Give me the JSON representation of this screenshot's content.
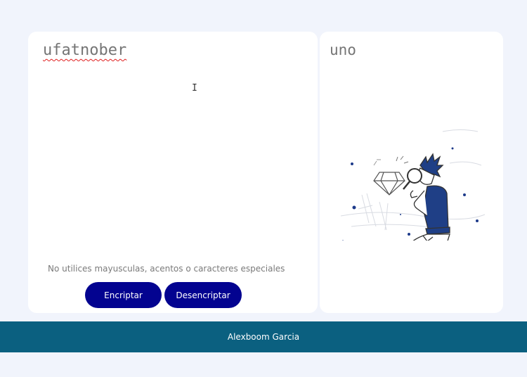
{
  "encryptor": {
    "input_value": "ufatnober",
    "warning": "No utilices mayusculas, acentos o caracteres especiales",
    "encrypt_label": "Encriptar",
    "decrypt_label": "Desencriptar"
  },
  "output": {
    "value": "uno",
    "illustration": "person-with-magnifying-glass-diamond-illustration"
  },
  "footer": {
    "text": "Alexboom Garcia"
  },
  "colors": {
    "background": "#f1f4fc",
    "button": "#030390",
    "footer": "#0b6080"
  }
}
